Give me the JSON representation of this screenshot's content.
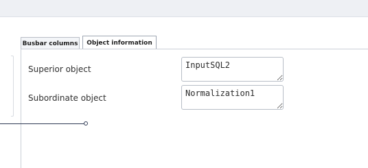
{
  "tabs": {
    "busbar_columns": "Busbar columns",
    "object_information": "Object information"
  },
  "object_information": {
    "superior_object_label": "Superior object",
    "superior_object_value": "InputSQL2",
    "subordinate_object_label": "Subordinate object",
    "subordinate_object_value": "Normalization1"
  },
  "colors": {
    "panel_border": "#c9ced6",
    "field_border": "#b7bdc6",
    "connector": "#2f3a54"
  }
}
